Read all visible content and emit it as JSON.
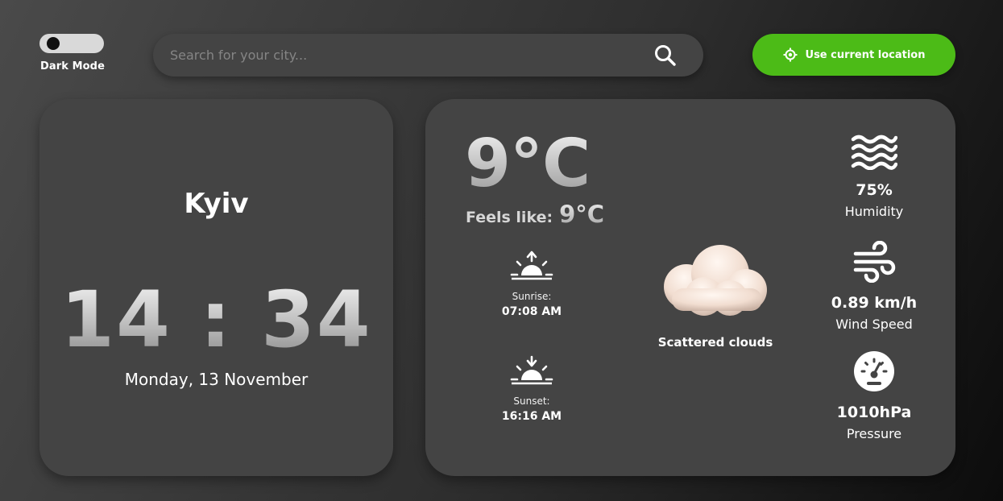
{
  "header": {
    "dark_mode_label": "Dark Mode",
    "dark_mode_on": true,
    "search_placeholder": "Search for your city...",
    "search_value": "",
    "location_button_label": "Use current location",
    "accent_color": "#4cbb17"
  },
  "city_card": {
    "city": "Kyiv",
    "time": "14 : 34",
    "date": "Monday, 13 November"
  },
  "weather_card": {
    "temperature": "9°C",
    "feels_like_label": "Feels like:",
    "feels_like_value": "9°C",
    "sunrise_label": "Sunrise:",
    "sunrise_time": "07:08 AM",
    "sunset_label": "Sunset:",
    "sunset_time": "16:16 AM",
    "condition_icon": "cloud-icon",
    "condition": "Scattered clouds",
    "humidity_value": "75%",
    "humidity_label": "Humidity",
    "wind_value": "0.89 km/h",
    "wind_label": "Wind Speed",
    "pressure_value": "1010hPa",
    "pressure_label": "Pressure"
  }
}
